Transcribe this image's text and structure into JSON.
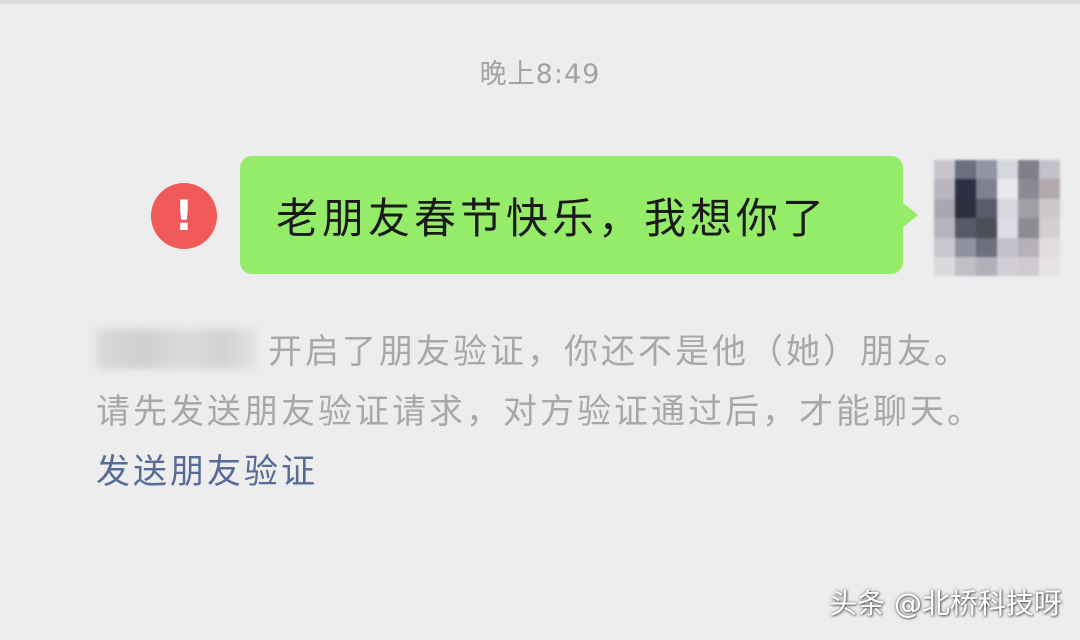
{
  "chat": {
    "timestamp": "晚上8:49",
    "message": {
      "text": "老朋友春节快乐，我想你了",
      "status_icon": "error-exclamation-icon",
      "status_symbol": "!",
      "bubble_color": "#95ec69",
      "status_color": "#f05a5a"
    },
    "avatar": {
      "blurred": true,
      "mosaic_colors": [
        "#c9c4cc",
        "#6b6f80",
        "#9095a3",
        "#d6d6dd",
        "#7f808c",
        "#c4c2c9",
        "#b9b6c0",
        "#2c3042",
        "#7d8290",
        "#e9e9ee",
        "#8c8994",
        "#b3aab0",
        "#a9a7b1",
        "#2b2f3e",
        "#595b68",
        "#d8d8de",
        "#a39fa6",
        "#cdc7cb",
        "#b7b3bd",
        "#565a68",
        "#4b4d59",
        "#dcdce2",
        "#8e8b93",
        "#d4cfd2",
        "#cac7cf",
        "#8f929e",
        "#6d707c",
        "#c5c3ca",
        "#b6b1b6",
        "#e0dcdf",
        "#dbd9de",
        "#c1bfc6",
        "#b2b0b8",
        "#d1cfd5",
        "#cfcbd0",
        "#e6e3e6"
      ]
    },
    "notice": {
      "text_before_link": "开启了朋友验证，你还不是他（她）朋友。请先发送朋友验证请求，对方验证通过后，才能聊天。",
      "link_text": "发送朋友验证",
      "link_color": "#576b95"
    }
  },
  "watermark": "头条 @北桥科技呀"
}
